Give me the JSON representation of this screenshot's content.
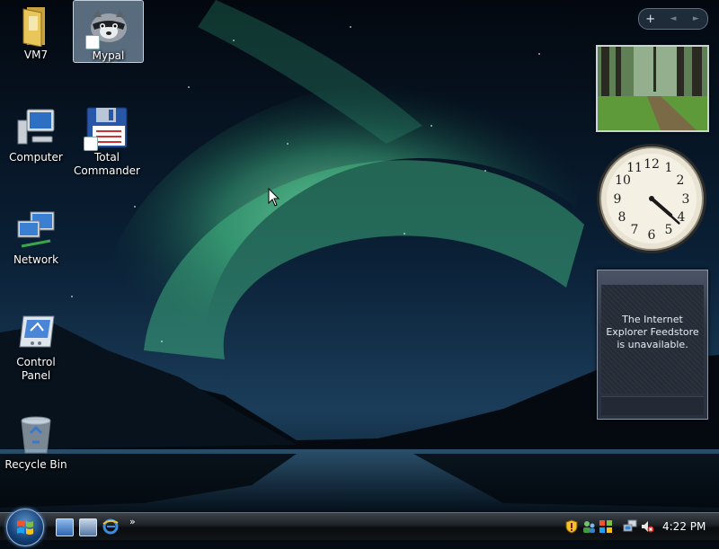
{
  "desktop": {
    "icons": [
      {
        "label": "VM7"
      },
      {
        "label": "Mypal"
      },
      {
        "label": "Computer"
      },
      {
        "label": "Total Commander"
      },
      {
        "label": "Network"
      },
      {
        "label": "Control Panel"
      },
      {
        "label": "Recycle Bin"
      }
    ]
  },
  "gadgets": {
    "toolbar": {
      "add": "+",
      "prev": "◄",
      "next": "►"
    },
    "clock": {
      "numbers": [
        "12",
        "1",
        "2",
        "3",
        "4",
        "5",
        "6",
        "7",
        "8",
        "9",
        "10",
        "11"
      ]
    },
    "feed": {
      "message": "The Internet Explorer Feedstore is unavailable."
    }
  },
  "taskbar": {
    "more_label": "»",
    "clock": "4:22 PM"
  }
}
